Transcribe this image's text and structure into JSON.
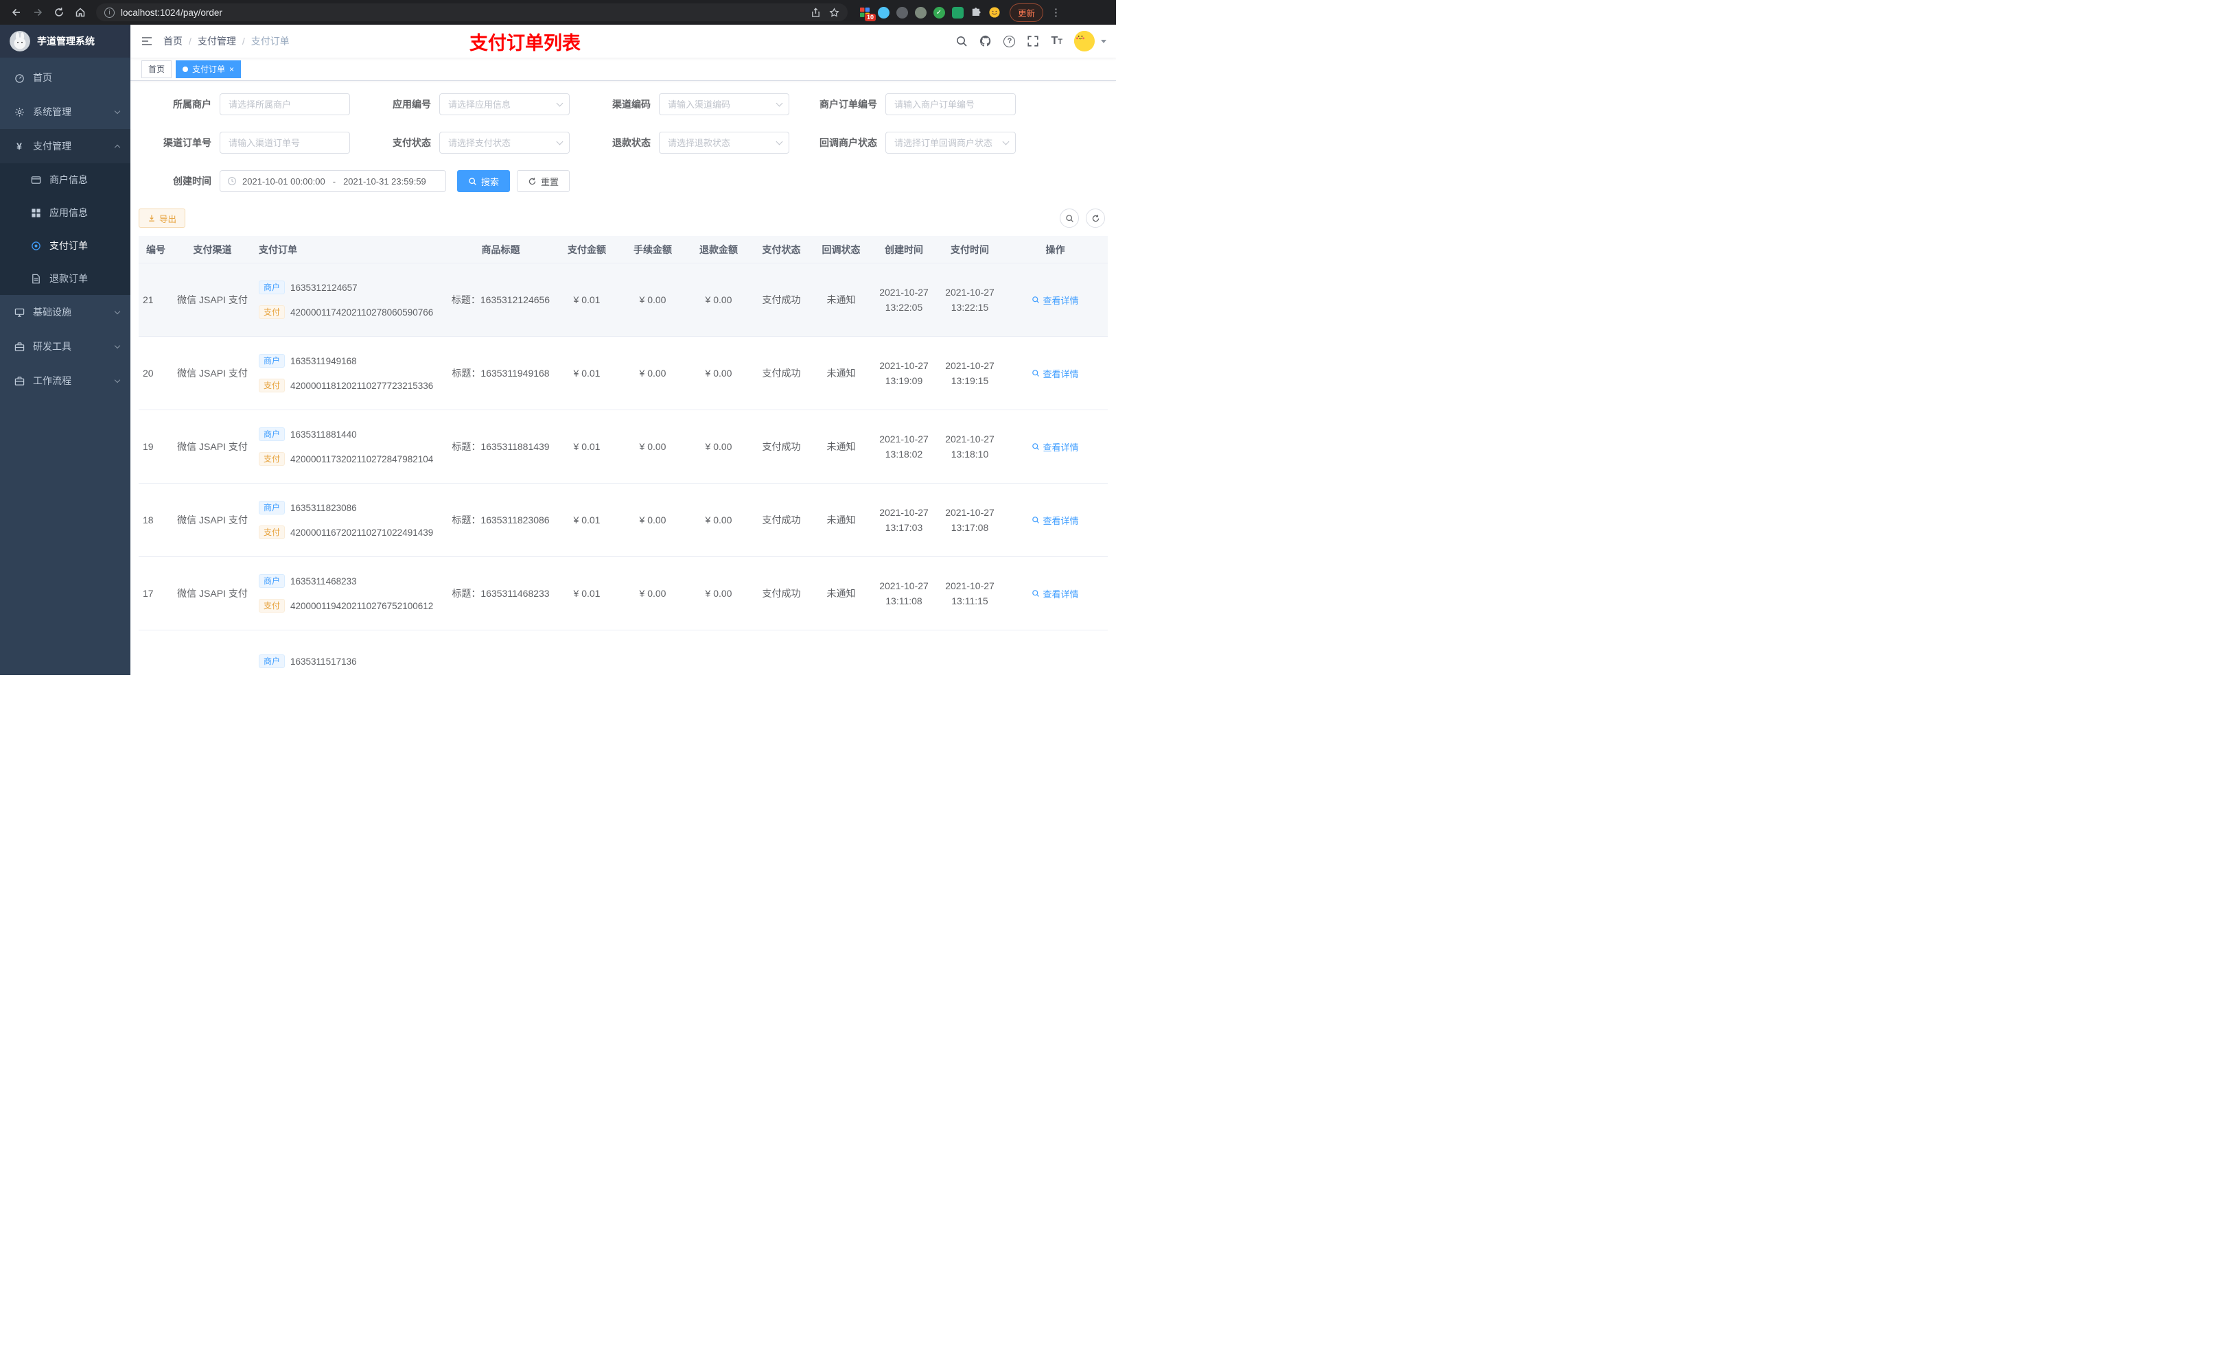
{
  "browser": {
    "url": "localhost:1024/pay/order",
    "update_label": "更新",
    "extension_badge": "10"
  },
  "colors": {
    "accent": "#409eff",
    "banner": "#ff0000",
    "warning": "#e6a23c",
    "sidebar_bg": "#304156"
  },
  "icons": [
    "back-icon",
    "forward-icon",
    "refresh-icon",
    "home-icon",
    "info-icon",
    "share-icon",
    "star-icon",
    "extensions-puzzle-icon",
    "search-icon",
    "github-icon",
    "help-icon",
    "fullscreen-icon",
    "fontsize-icon",
    "chevron-down-icon",
    "clock-icon",
    "download-icon",
    "magnifier-icon"
  ],
  "sidebar": {
    "title": "芋道管理系统",
    "items": [
      {
        "label": "首页"
      },
      {
        "label": "系统管理"
      },
      {
        "label": "支付管理",
        "children": [
          {
            "label": "商户信息"
          },
          {
            "label": "应用信息"
          },
          {
            "label": "支付订单"
          },
          {
            "label": "退款订单"
          }
        ]
      },
      {
        "label": "基础设施"
      },
      {
        "label": "研发工具"
      },
      {
        "label": "工作流程"
      }
    ]
  },
  "header": {
    "breadcrumb": [
      "首页",
      "支付管理",
      "支付订单"
    ],
    "banner": "支付订单列表"
  },
  "tabs": [
    {
      "label": "首页"
    },
    {
      "label": "支付订单"
    }
  ],
  "filters": {
    "fields": [
      {
        "label": "所属商户",
        "placeholder": "请选择所属商户"
      },
      {
        "label": "应用编号",
        "placeholder": "请选择应用信息"
      },
      {
        "label": "渠道编码",
        "placeholder": "请输入渠道编码"
      },
      {
        "label": "商户订单编号",
        "placeholder": "请输入商户订单编号"
      },
      {
        "label": "渠道订单号",
        "placeholder": "请输入渠道订单号"
      },
      {
        "label": "支付状态",
        "placeholder": "请选择支付状态"
      },
      {
        "label": "退款状态",
        "placeholder": "请选择退款状态"
      },
      {
        "label": "回调商户状态",
        "placeholder": "请选择订单回调商户状态"
      }
    ],
    "create_time": {
      "label": "创建时间",
      "start": "2021-10-01 00:00:00",
      "separator": "-",
      "end": "2021-10-31 23:59:59"
    },
    "search_label": "搜索",
    "reset_label": "重置"
  },
  "toolbar": {
    "export_label": "导出"
  },
  "table": {
    "columns": [
      "编号",
      "支付渠道",
      "支付订单",
      "商品标题",
      "支付金额",
      "手续金额",
      "退款金额",
      "支付状态",
      "回调状态",
      "创建时间",
      "支付时间",
      "操作"
    ],
    "rows": [
      {
        "id": "21",
        "channel": "微信 JSAPI 支付",
        "merchant_tag": "商户",
        "merchant_no": "1635312124657",
        "pay_tag": "支付",
        "pay_no": "4200001174202110278060590766",
        "title": "标题：1635312124656",
        "amount": "¥ 0.01",
        "fee": "¥ 0.00",
        "refund": "¥ 0.00",
        "status": "支付成功",
        "notify": "未通知",
        "create_date": "2021-10-27",
        "create_time": "13:22:05",
        "pay_date": "2021-10-27",
        "pay_time": "13:22:15",
        "action": "查看详情"
      },
      {
        "id": "20",
        "channel": "微信 JSAPI 支付",
        "merchant_tag": "商户",
        "merchant_no": "1635311949168",
        "pay_tag": "支付",
        "pay_no": "4200001181202110277723215336",
        "title": "标题：1635311949168",
        "amount": "¥ 0.01",
        "fee": "¥ 0.00",
        "refund": "¥ 0.00",
        "status": "支付成功",
        "notify": "未通知",
        "create_date": "2021-10-27",
        "create_time": "13:19:09",
        "pay_date": "2021-10-27",
        "pay_time": "13:19:15",
        "action": "查看详情"
      },
      {
        "id": "19",
        "channel": "微信 JSAPI 支付",
        "merchant_tag": "商户",
        "merchant_no": "1635311881440",
        "pay_tag": "支付",
        "pay_no": "4200001173202110272847982104",
        "title": "标题：1635311881439",
        "amount": "¥ 0.01",
        "fee": "¥ 0.00",
        "refund": "¥ 0.00",
        "status": "支付成功",
        "notify": "未通知",
        "create_date": "2021-10-27",
        "create_time": "13:18:02",
        "pay_date": "2021-10-27",
        "pay_time": "13:18:10",
        "action": "查看详情"
      },
      {
        "id": "18",
        "channel": "微信 JSAPI 支付",
        "merchant_tag": "商户",
        "merchant_no": "1635311823086",
        "pay_tag": "支付",
        "pay_no": "4200001167202110271022491439",
        "title": "标题：1635311823086",
        "amount": "¥ 0.01",
        "fee": "¥ 0.00",
        "refund": "¥ 0.00",
        "status": "支付成功",
        "notify": "未通知",
        "create_date": "2021-10-27",
        "create_time": "13:17:03",
        "pay_date": "2021-10-27",
        "pay_time": "13:17:08",
        "action": "查看详情"
      },
      {
        "id": "17",
        "channel": "微信 JSAPI 支付",
        "merchant_tag": "商户",
        "merchant_no": "1635311468233",
        "pay_tag": "支付",
        "pay_no": "4200001194202110276752100612",
        "title": "标题：1635311468233",
        "amount": "¥ 0.01",
        "fee": "¥ 0.00",
        "refund": "¥ 0.00",
        "status": "支付成功",
        "notify": "未通知",
        "create_date": "2021-10-27",
        "create_time": "13:11:08",
        "pay_date": "2021-10-27",
        "pay_time": "13:11:15",
        "action": "查看详情"
      }
    ],
    "partial_row": {
      "merchant_tag": "商户",
      "merchant_no": "1635311517136"
    }
  }
}
